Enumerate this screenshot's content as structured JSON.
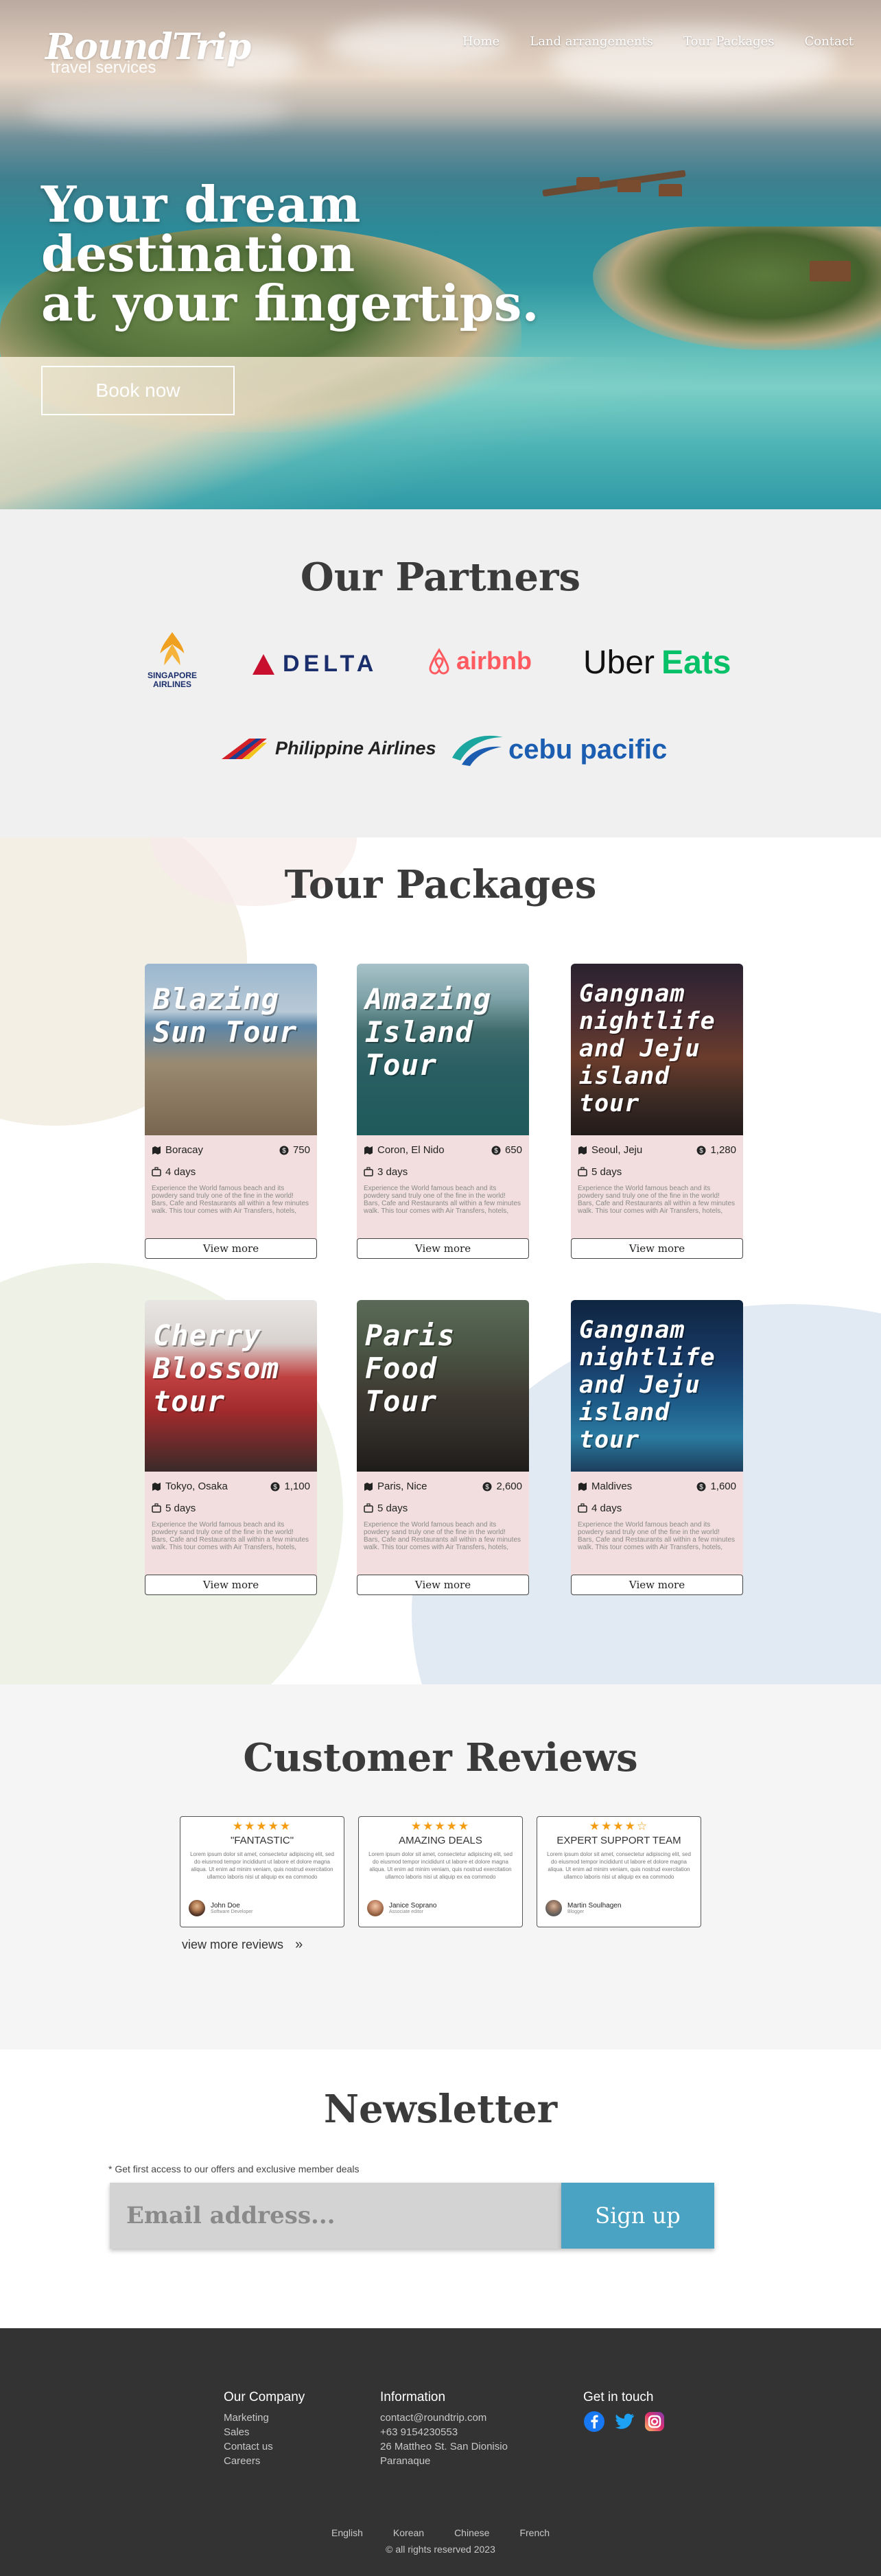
{
  "brand": {
    "name": "RoundTrip",
    "tagline": "travel services"
  },
  "nav": {
    "items": [
      "Home",
      "Land arrangements",
      "Tour Packages",
      "Contact"
    ]
  },
  "hero": {
    "title_lines": [
      "Your dream",
      "destination",
      "at your fingertips."
    ],
    "cta": "Book now"
  },
  "partners": {
    "title": "Our Partners",
    "logos": {
      "singapore": "SINGAPORE\nAIRLINES",
      "delta": "DELTA",
      "airbnb": "airbnb",
      "uber": "Uber",
      "eats": "Eats",
      "philippine": "Philippine Airlines",
      "cebu": "cebu pacific"
    }
  },
  "tours": {
    "title": "Tour Packages",
    "view_label": "View more",
    "description": "Experience the World famous beach and its powdery sand truly one of the fine in the world! Bars, Cafe and Restaurants all within a few minutes walk. This tour comes with Air Transfers, hotels, Breakfast and tour.",
    "cards": [
      {
        "title": "Blazing Sun Tour",
        "location": "Boracay",
        "price": "750",
        "days": "4 days"
      },
      {
        "title": "Amazing Island Tour",
        "location": "Coron, El Nido",
        "price": "650",
        "days": "3 days"
      },
      {
        "title": "Gangnam nightlife and Jeju island tour",
        "location": "Seoul, Jeju",
        "price": "1,280",
        "days": "5 days"
      },
      {
        "title": "Cherry Blossom tour",
        "location": "Tokyo, Osaka",
        "price": "1,100",
        "days": "5 days"
      },
      {
        "title": "Paris Food Tour",
        "location": "Paris, Nice",
        "price": "2,600",
        "days": "5 days"
      },
      {
        "title": "Gangnam nightlife and Jeju island tour",
        "location": "Maldives",
        "price": "1,600",
        "days": "4 days"
      }
    ]
  },
  "reviews": {
    "title": "Customer Reviews",
    "more_label": "view more reviews",
    "items": [
      {
        "stars": "★★★★★",
        "title": "\"FANTASTIC\"",
        "body": "Lorem ipsum dolor sit amet, consectetur adipiscing elit, sed do eiusmod tempor incididunt ut labore et dolore magna aliqua. Ut enim ad minim veniam, quis nostrud exercitation ullamco laboris nisi ut aliquip ex ea commodo",
        "name": "John Doe",
        "role": "Software Developer",
        "rating": 5
      },
      {
        "stars": "★★★★★",
        "title": "AMAZING DEALS",
        "body": "Lorem ipsum dolor sit amet, consectetur adipiscing elit, sed do eiusmod tempor incididunt ut labore et dolore magna aliqua. Ut enim ad minim veniam, quis nostrud exercitation ullamco laboris nisi ut aliquip ex ea commodo",
        "name": "Janice Soprano",
        "role": "Associate editor",
        "rating": 5
      },
      {
        "stars": "★★★★☆",
        "title": "EXPERT SUPPORT TEAM",
        "body": "Lorem ipsum dolor sit amet, consectetur adipiscing elit, sed do eiusmod tempor incididunt ut labore et dolore magna aliqua. Ut enim ad minim veniam, quis nostrud exercitation ullamco laboris nisi ut aliquip ex ea commodo",
        "name": "Martin Soulhagen",
        "role": "Blogger",
        "rating": 4.5
      }
    ]
  },
  "newsletter": {
    "title": "Newsletter",
    "note": "* Get first access to our offers and exclusive member deals",
    "placeholder": "Email address...",
    "button": "Sign up"
  },
  "footer": {
    "company": {
      "title": "Our Company",
      "links": [
        "Marketing",
        "Sales",
        "Contact us",
        "Careers"
      ]
    },
    "info": {
      "title": "Information",
      "lines": [
        "contact@roundtrip.com",
        "+63 9154230553",
        "26 Mattheo St. San Dionisio",
        "Paranaque"
      ]
    },
    "touch": {
      "title": "Get in touch",
      "icons": [
        "facebook-icon",
        "twitter-icon",
        "instagram-icon"
      ]
    },
    "languages": [
      "English",
      "Korean",
      "Chinese",
      "French"
    ],
    "copyright": "© all rights reserved 2023"
  },
  "colors": {
    "accent": "#4ba3c3",
    "card_body": "#f2dede",
    "footer": "#333333",
    "star": "#f39c12"
  }
}
